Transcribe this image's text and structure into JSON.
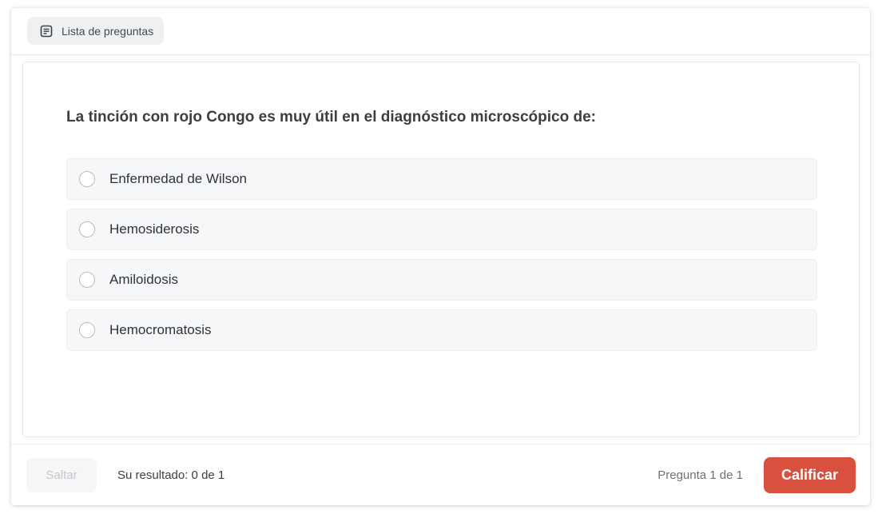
{
  "header": {
    "list_button_label": "Lista de preguntas",
    "list_icon": "list-document-icon"
  },
  "question": {
    "text": "La tinción con rojo Congo es muy útil en el diagnóstico microscópico de:",
    "options": [
      {
        "label": "Enfermedad de Wilson",
        "selected": false
      },
      {
        "label": "Hemosiderosis",
        "selected": false
      },
      {
        "label": "Amiloidosis",
        "selected": false
      },
      {
        "label": "Hemocromatosis",
        "selected": false
      }
    ]
  },
  "footer": {
    "skip_label": "Saltar",
    "result_text": "Su resultado: 0 de 1",
    "counter_text": "Pregunta 1 de 1",
    "grade_label": "Calificar"
  },
  "colors": {
    "accent": "#d9503f",
    "option_bg": "#f6f7f8",
    "chip_bg": "#eef0f2"
  }
}
